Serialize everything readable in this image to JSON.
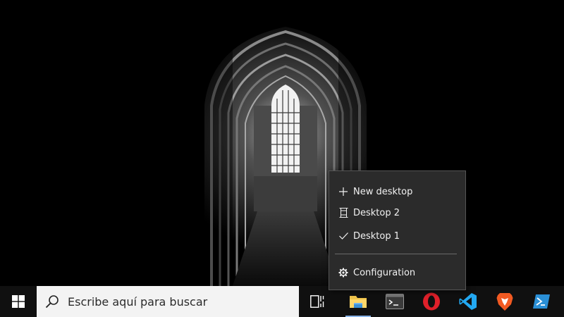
{
  "menu": {
    "new_desktop": "New desktop",
    "desktop_2": "Desktop 2",
    "desktop_1": "Desktop 1",
    "configuration": "Configuration",
    "current_desktop": "Desktop 1"
  },
  "taskbar": {
    "search_placeholder": "Escribe aquí para buscar",
    "apps": [
      "file-explorer",
      "terminal",
      "opera",
      "vscode",
      "brave",
      "powershell"
    ]
  },
  "colors": {
    "menu_bg": "#2b2b2b",
    "taskbar_bg": "#101010",
    "search_bg": "#f3f3f3",
    "opera_red": "#e0202a",
    "vscode_blue": "#23a9f2",
    "brave_orange": "#f25a22"
  }
}
